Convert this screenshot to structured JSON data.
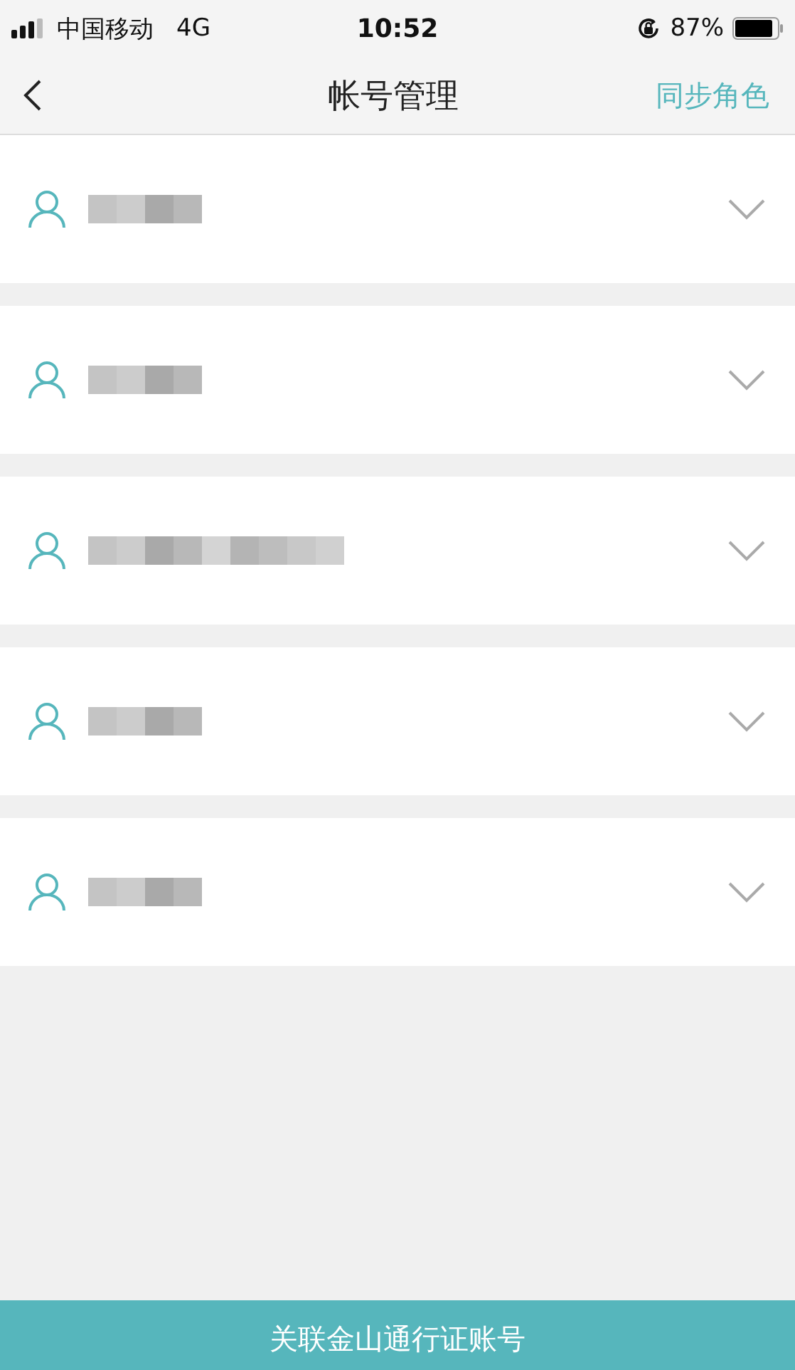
{
  "status_bar": {
    "carrier": "中国移动",
    "network": "4G",
    "time": "10:52",
    "battery": "87%"
  },
  "nav": {
    "title": "帐号管理",
    "action": "同步角色"
  },
  "accounts": [
    {
      "kind": "short",
      "expanded": false
    },
    {
      "kind": "short",
      "expanded": false
    },
    {
      "kind": "long",
      "expanded": false
    },
    {
      "kind": "short",
      "expanded": false
    },
    {
      "kind": "short",
      "expanded": false
    }
  ],
  "bottom_button": "关联金山通行证账号"
}
